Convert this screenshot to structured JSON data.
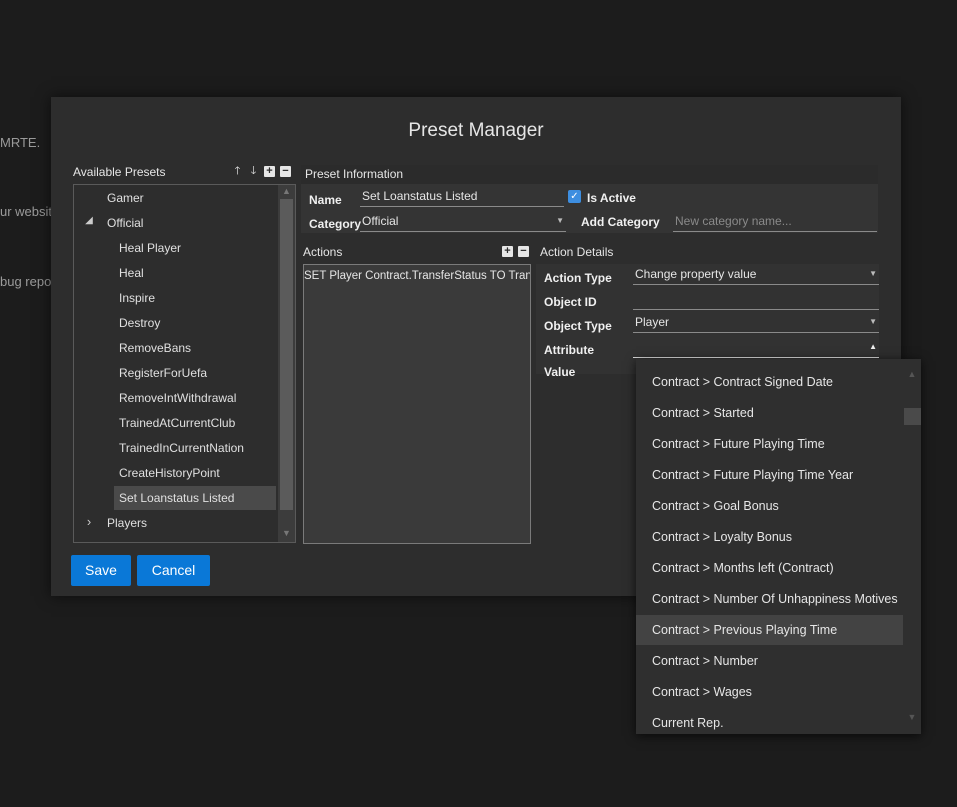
{
  "background": {
    "texts": [
      "MRTE.",
      "ur websit",
      "bug repo"
    ]
  },
  "dialog": {
    "title": "Preset Manager",
    "available_presets": {
      "header": "Available Presets",
      "tree": [
        {
          "label": "Gamer",
          "level": 0,
          "expander": ""
        },
        {
          "label": "Official",
          "level": 0,
          "expander": "◢"
        },
        {
          "label": "Heal Player",
          "level": 1
        },
        {
          "label": "Heal",
          "level": 1
        },
        {
          "label": "Inspire",
          "level": 1
        },
        {
          "label": "Destroy",
          "level": 1
        },
        {
          "label": "RemoveBans",
          "level": 1
        },
        {
          "label": "RegisterForUefa",
          "level": 1
        },
        {
          "label": "RemoveIntWithdrawal",
          "level": 1
        },
        {
          "label": "TrainedAtCurrentClub",
          "level": 1
        },
        {
          "label": "TrainedInCurrentNation",
          "level": 1
        },
        {
          "label": "CreateHistoryPoint",
          "level": 1
        },
        {
          "label": "Set Loanstatus Listed",
          "level": 1,
          "selected": true
        },
        {
          "label": "Players",
          "level": 0,
          "expander": "›"
        }
      ]
    },
    "preset_info": {
      "header": "Preset Information",
      "name_label": "Name",
      "name_value": "Set Loanstatus Listed",
      "is_active_label": "Is Active",
      "is_active": true,
      "category_label": "Category",
      "category_value": "Official",
      "add_category_label": "Add Category",
      "add_category_placeholder": "New category name..."
    },
    "actions": {
      "header": "Actions",
      "items": [
        "SET Player Contract.TransferStatus TO Transfer Listed"
      ]
    },
    "action_details": {
      "header": "Action Details",
      "action_type_label": "Action Type",
      "action_type_value": "Change property value",
      "object_id_label": "Object ID",
      "object_id_value": "",
      "object_type_label": "Object Type",
      "object_type_value": "Player",
      "attribute_label": "Attribute",
      "attribute_value": "",
      "value_label": "Value"
    },
    "buttons": {
      "save": "Save",
      "cancel": "Cancel"
    }
  },
  "attribute_dropdown": {
    "options": [
      "Contract > Contract Signed Date",
      "Contract > Started",
      "Contract > Future Playing Time",
      "Contract > Future Playing Time Year",
      "Contract > Goal Bonus",
      "Contract > Loyalty Bonus",
      "Contract > Months left (Contract)",
      "Contract > Number Of Unhappiness Motives",
      "Contract > Previous Playing Time",
      "Contract > Number",
      "Contract > Wages",
      "Current Rep."
    ],
    "highlighted_index": 8
  },
  "colors": {
    "accent": "#0a78d7",
    "checkbox": "#3d8ee0",
    "dialog_bg": "#2d2d2d"
  }
}
